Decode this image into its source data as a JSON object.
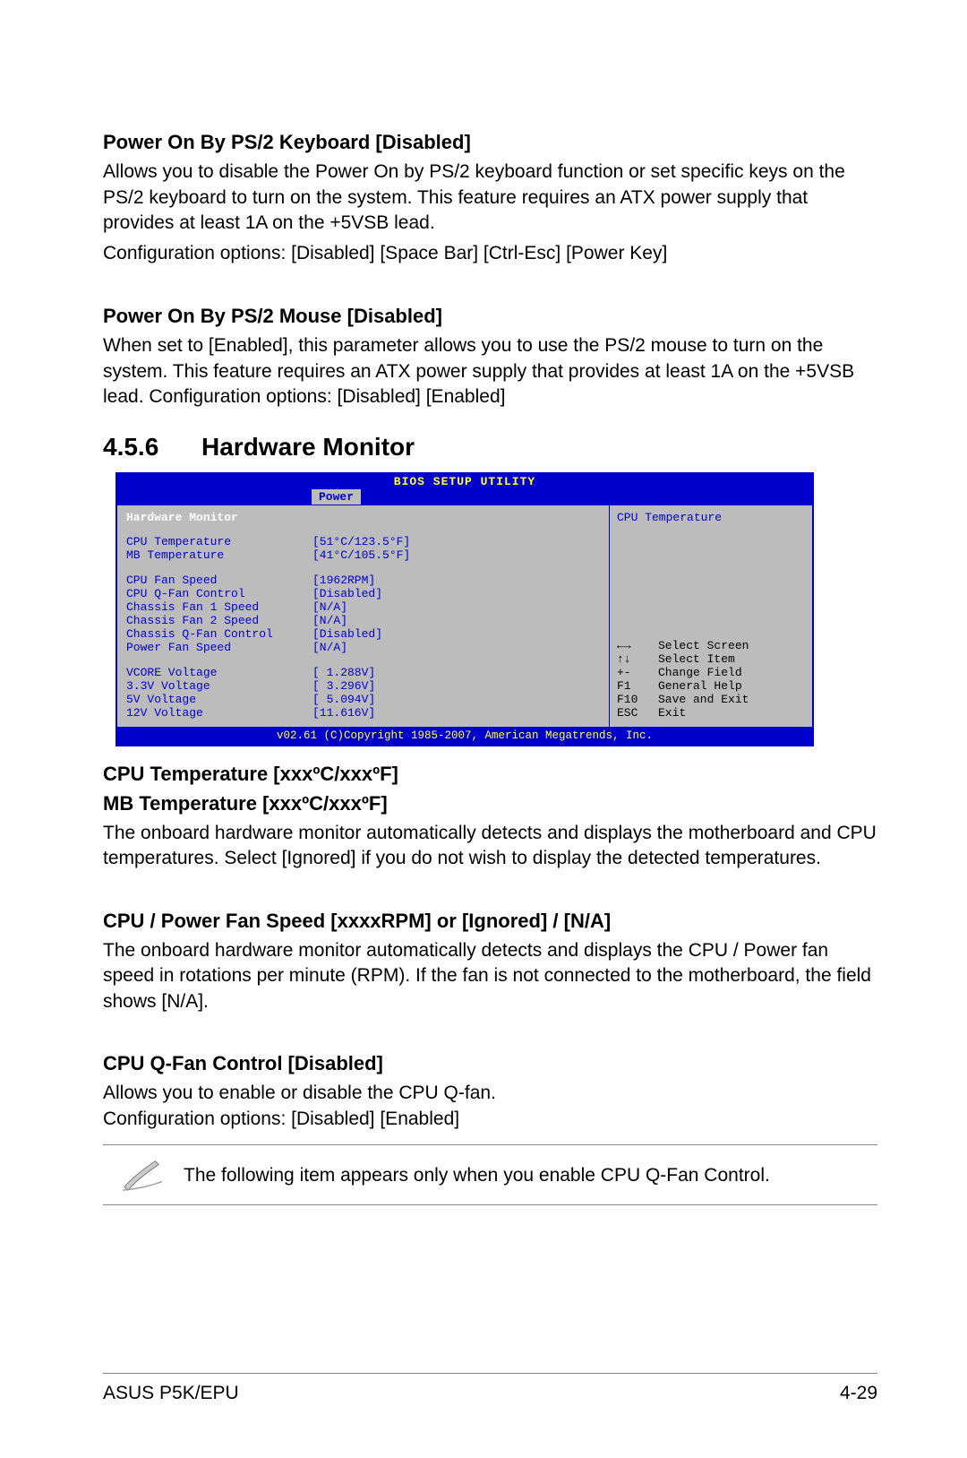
{
  "s1": {
    "heading": "Power On By PS/2 Keyboard [Disabled]",
    "body": "Allows you to disable the Power On by PS/2 keyboard function or set specific keys on the PS/2 keyboard to turn on the system. This feature requires an ATX power supply that provides at least 1A on the +5VSB lead.",
    "opts": "Configuration options: [Disabled] [Space Bar] [Ctrl-Esc] [Power Key]"
  },
  "s2": {
    "heading": "Power On By PS/2 Mouse [Disabled]",
    "body": "When set to [Enabled], this parameter allows you to use the PS/2 mouse to turn on the system. This feature requires an ATX power supply that provides at least 1A on the +5VSB lead. Configuration options: [Disabled] [Enabled]"
  },
  "subsection": {
    "number": "4.5.6",
    "title": "Hardware Monitor"
  },
  "bios": {
    "title": "BIOS SETUP UTILITY",
    "tab": "Power",
    "leftTitle": "Hardware Monitor",
    "rows1": [
      {
        "label": "CPU Temperature",
        "value": "[51°C/123.5°F]"
      },
      {
        "label": "MB Temperature",
        "value": "[41°C/105.5°F]"
      }
    ],
    "rows2": [
      {
        "label": "CPU Fan Speed",
        "value": "[1962RPM]"
      },
      {
        "label": "CPU Q-Fan Control",
        "value": "[Disabled]"
      },
      {
        "label": "Chassis Fan 1 Speed",
        "value": "[N/A]"
      },
      {
        "label": "Chassis Fan 2 Speed",
        "value": "[N/A]"
      },
      {
        "label": "Chassis Q-Fan Control",
        "value": "[Disabled]"
      },
      {
        "label": "Power Fan Speed",
        "value": "[N/A]"
      }
    ],
    "rows3": [
      {
        "label": "VCORE Voltage",
        "value": "[ 1.288V]"
      },
      {
        "label": "3.3V  Voltage",
        "value": "[ 3.296V]"
      },
      {
        "label": "5V    Voltage",
        "value": "[ 5.094V]"
      },
      {
        "label": "12V   Voltage",
        "value": "[11.616V]"
      }
    ],
    "rightTitle": "CPU Temperature",
    "help": [
      {
        "key": "←→",
        "text": "Select Screen",
        "icon": "arrows-lr"
      },
      {
        "key": "↑↓",
        "text": "Select Item",
        "icon": "arrows-ud"
      },
      {
        "key": "+-",
        "text": "Change Field"
      },
      {
        "key": "F1",
        "text": "General Help"
      },
      {
        "key": "F10",
        "text": "Save and Exit"
      },
      {
        "key": "ESC",
        "text": "Exit"
      }
    ],
    "footer": "v02.61 (C)Copyright 1985-2007, American Megatrends, Inc."
  },
  "s3": {
    "heading1": "CPU Temperature [xxxºC/xxxºF]",
    "heading2": "MB Temperature [xxxºC/xxxºF]",
    "body": "The onboard hardware monitor automatically detects and displays the motherboard and CPU temperatures. Select [Ignored] if you do not wish to display the detected temperatures."
  },
  "s4": {
    "heading": "CPU / Power Fan Speed [xxxxRPM] or [Ignored] / [N/A]",
    "body": "The onboard hardware monitor automatically detects and displays the CPU / Power fan speed in rotations per minute (RPM). If the fan is not connected to the motherboard, the field shows [N/A]."
  },
  "s5": {
    "heading": "CPU Q-Fan Control [Disabled]",
    "body1": "Allows you to enable or disable the CPU Q-fan.",
    "body2": "Configuration options: [Disabled] [Enabled]"
  },
  "note": "The following item appears only when you enable CPU Q-Fan Control.",
  "footer": {
    "left": "ASUS P5K/EPU",
    "right": "4-29"
  }
}
